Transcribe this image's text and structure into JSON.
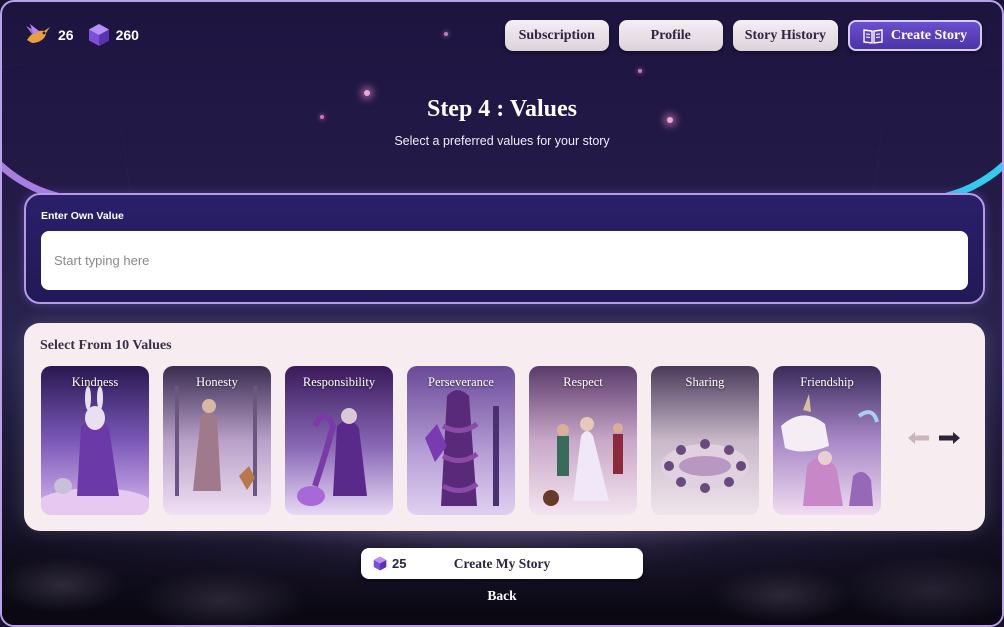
{
  "stats": {
    "birds": "26",
    "gems": "260"
  },
  "nav": {
    "subscription": "Subscription",
    "profile": "Profile",
    "story_history": "Story History",
    "create_story": "Create Story"
  },
  "step": {
    "title": "Step 4 : Values",
    "subtitle": "Select a preferred values for your story"
  },
  "own_value": {
    "label": "Enter Own Value",
    "placeholder": "Start typing here",
    "value": ""
  },
  "values": {
    "title": "Select From 10 Values",
    "items": [
      {
        "label": "Kindness"
      },
      {
        "label": "Honesty"
      },
      {
        "label": "Responsibility"
      },
      {
        "label": "Perseverance"
      },
      {
        "label": "Respect"
      },
      {
        "label": "Sharing"
      },
      {
        "label": "Friendship"
      }
    ]
  },
  "cta": {
    "cost": "25",
    "label": "Create My Story"
  },
  "back": "Back",
  "colors": {
    "accent": "#5a40c0",
    "panel_dark": "#241a5c",
    "panel_light": "#f7ecef",
    "arc_left": "#b68cf0",
    "arc_right": "#35d6f5"
  }
}
